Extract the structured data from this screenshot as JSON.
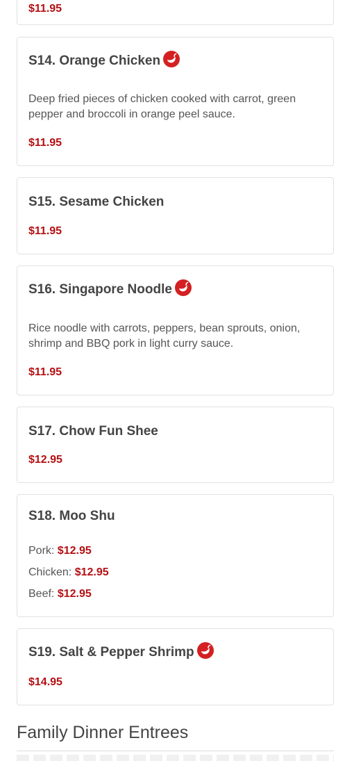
{
  "colors": {
    "price": "#b50f12",
    "spicy_icon": "#d42022",
    "text": "#444444",
    "border": "#e1e1e1"
  },
  "top_partial_price": "$11.95",
  "items": {
    "s14": {
      "name": "S14. Orange Chicken",
      "spicy": true,
      "icon": "chili-pepper-icon",
      "description": "Deep fried pieces of chicken cooked with carrot, green pepper and broccoli in orange peel sauce.",
      "price": "$11.95"
    },
    "s15": {
      "name": "S15. Sesame Chicken",
      "spicy": false,
      "price": "$11.95"
    },
    "s16": {
      "name": "S16. Singapore Noodle",
      "spicy": true,
      "icon": "chili-pepper-icon",
      "description": "Rice noodle with carrots, peppers, bean sprouts, onion, shrimp and BBQ pork in light curry sauce.",
      "price": "$11.95"
    },
    "s17": {
      "name": "S17. Chow Fun Shee",
      "spicy": false,
      "price": "$12.95"
    },
    "s18": {
      "name": "S18. Moo Shu",
      "spicy": false,
      "options": [
        {
          "label": "Pork:",
          "price": "$12.95"
        },
        {
          "label": "Chicken:",
          "price": "$12.95"
        },
        {
          "label": "Beef:",
          "price": "$12.95"
        }
      ]
    },
    "s19": {
      "name": "S19. Salt & Pepper Shrimp",
      "spicy": true,
      "icon": "chili-pepper-icon",
      "price": "$14.95"
    }
  },
  "next_section": {
    "title": "Family Dinner Entrees"
  }
}
